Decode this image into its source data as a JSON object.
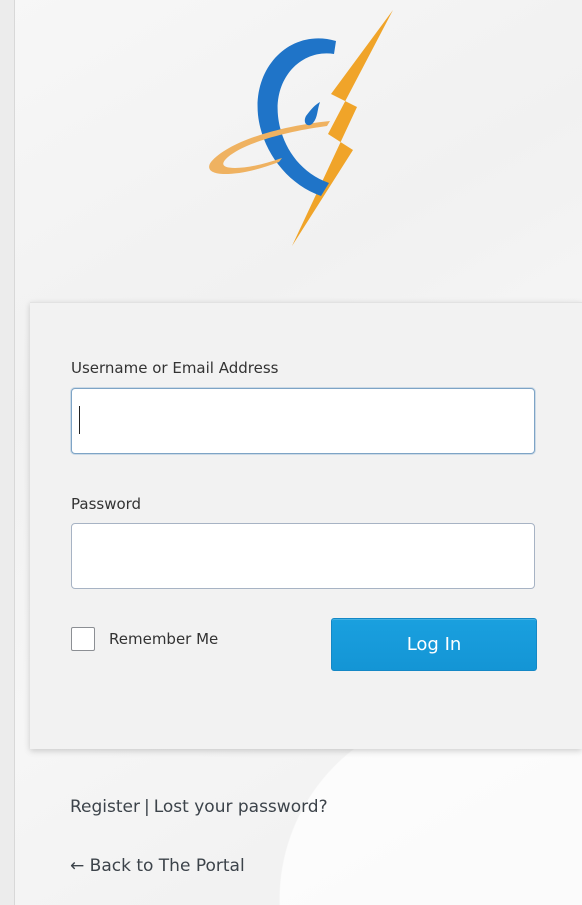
{
  "logo": {
    "name": "brand-logo"
  },
  "login_form": {
    "username_label": "Username or Email Address",
    "username_value": "",
    "password_label": "Password",
    "password_value": "",
    "remember_label": "Remember Me",
    "remember_checked": false,
    "submit_label": "Log In"
  },
  "footer": {
    "register_label": "Register",
    "separator": "|",
    "lost_password_label": "Lost your password?",
    "back_arrow": "←",
    "back_label": "Back to The Portal"
  },
  "colors": {
    "button_primary": "#1a9ad8",
    "logo_blue": "#1f74c8",
    "logo_orange": "#f0a429",
    "text": "#3c434a"
  }
}
